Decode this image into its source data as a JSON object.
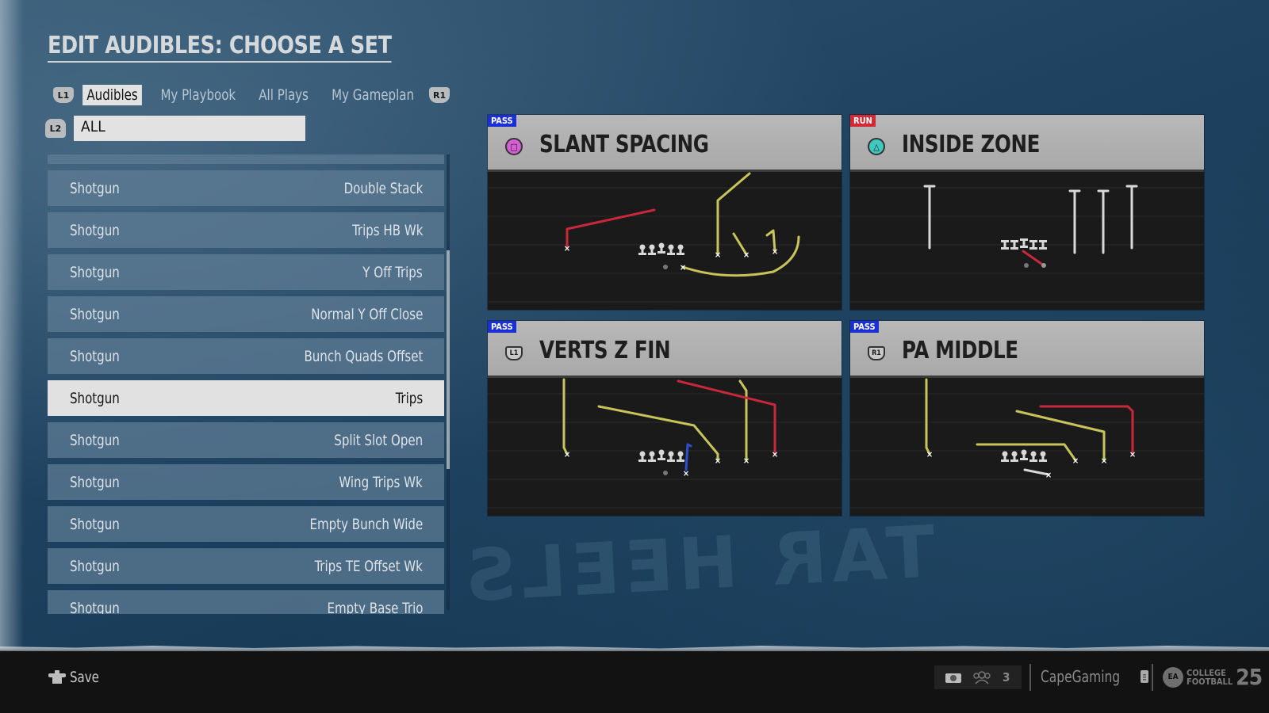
{
  "page": {
    "title": "EDIT AUDIBLES: CHOOSE A SET",
    "background_watermark": "TAR HEELS"
  },
  "tabs": {
    "prev_button": "L1",
    "next_button": "R1",
    "items": [
      {
        "label": "Audibles",
        "active": true
      },
      {
        "label": "My Playbook",
        "active": false
      },
      {
        "label": "All Plays",
        "active": false
      },
      {
        "label": "My Gameplan",
        "active": false
      }
    ]
  },
  "filter": {
    "button": "L2",
    "value": "ALL"
  },
  "formation_list": {
    "rows": [
      {
        "formation": "Shotgun",
        "set": "Double Stack",
        "selected": false
      },
      {
        "formation": "Shotgun",
        "set": "Trips HB Wk",
        "selected": false
      },
      {
        "formation": "Shotgun",
        "set": "Y Off Trips",
        "selected": false
      },
      {
        "formation": "Shotgun",
        "set": "Normal Y Off Close",
        "selected": false
      },
      {
        "formation": "Shotgun",
        "set": "Bunch Quads Offset",
        "selected": false
      },
      {
        "formation": "Shotgun",
        "set": "Trips",
        "selected": true
      },
      {
        "formation": "Shotgun",
        "set": "Split Slot Open",
        "selected": false
      },
      {
        "formation": "Shotgun",
        "set": "Wing Trips Wk",
        "selected": false
      },
      {
        "formation": "Shotgun",
        "set": "Empty Bunch Wide",
        "selected": false
      },
      {
        "formation": "Shotgun",
        "set": "Trips TE Offset Wk",
        "selected": false
      },
      {
        "formation": "Shotgun",
        "set": "Empty Base Trio",
        "selected": false
      }
    ],
    "scroll": {
      "thumb_start": 0.21,
      "thumb_end": 0.69
    }
  },
  "audibles": [
    {
      "type": "PASS",
      "type_color": "#1a2fd6",
      "button": "square",
      "button_glyph": "□",
      "button_color": "#d65fd6",
      "name": "SLANT SPACING"
    },
    {
      "type": "RUN",
      "type_color": "#d42a36",
      "button": "triangle",
      "button_glyph": "△",
      "button_color": "#3ec8c0",
      "name": "INSIDE ZONE"
    },
    {
      "type": "PASS",
      "type_color": "#1a2fd6",
      "button": "L1",
      "button_glyph": "L1",
      "button_color": "#c9c9c9",
      "name": "VERTS Z FIN"
    },
    {
      "type": "PASS",
      "type_color": "#1a2fd6",
      "button": "R1",
      "button_glyph": "R1",
      "button_color": "#c9c9c9",
      "name": "PA MIDDLE"
    }
  ],
  "colors": {
    "route_primary": "#c8c45a",
    "route_hot": "#c8283a",
    "route_motion": "#2b4fd0",
    "blocker": "#d8d8d8"
  },
  "footer": {
    "save_label": "Save",
    "party_count": "3",
    "gamertag": "CapeGaming",
    "brand_top": "COLLEGE",
    "brand_bottom": "FOOTBALL",
    "brand_year": "25"
  }
}
